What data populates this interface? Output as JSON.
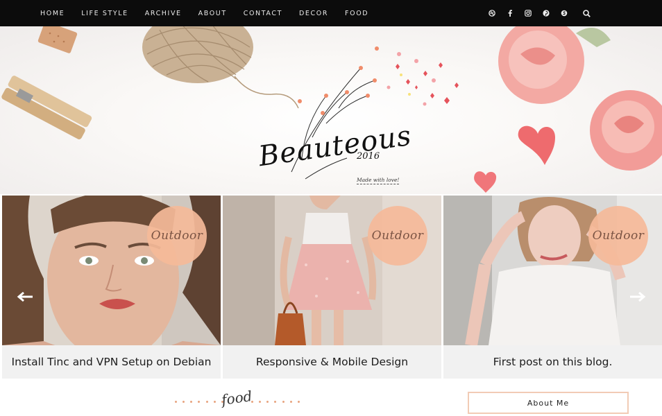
{
  "nav": {
    "items": [
      "HOME",
      "LIFE STYLE",
      "ARCHIVE",
      "ABOUT",
      "CONTACT",
      "DECOR",
      "FOOD"
    ]
  },
  "social": {
    "icons": [
      "dribbble-icon",
      "facebook-icon",
      "instagram-icon",
      "pinterest-icon",
      "skype-icon",
      "search-icon"
    ]
  },
  "header": {
    "logo_title": "Beauteous",
    "logo_year": "2016",
    "logo_tagline": "Made with love!"
  },
  "slider": {
    "slides": [
      {
        "badge": "Outdoor",
        "title": "Install Tinc and VPN Setup on Debian"
      },
      {
        "badge": "Outdoor",
        "title": "Responsive & Mobile Design"
      },
      {
        "badge": "Outdoor",
        "title": "First post on this blog."
      }
    ]
  },
  "sections": {
    "food_heading": "food",
    "about_heading": "About Me"
  },
  "colors": {
    "nav_bg": "#0c0c0c",
    "badge_peach": "#f5ba99",
    "accent_border": "#f2cbb5"
  }
}
